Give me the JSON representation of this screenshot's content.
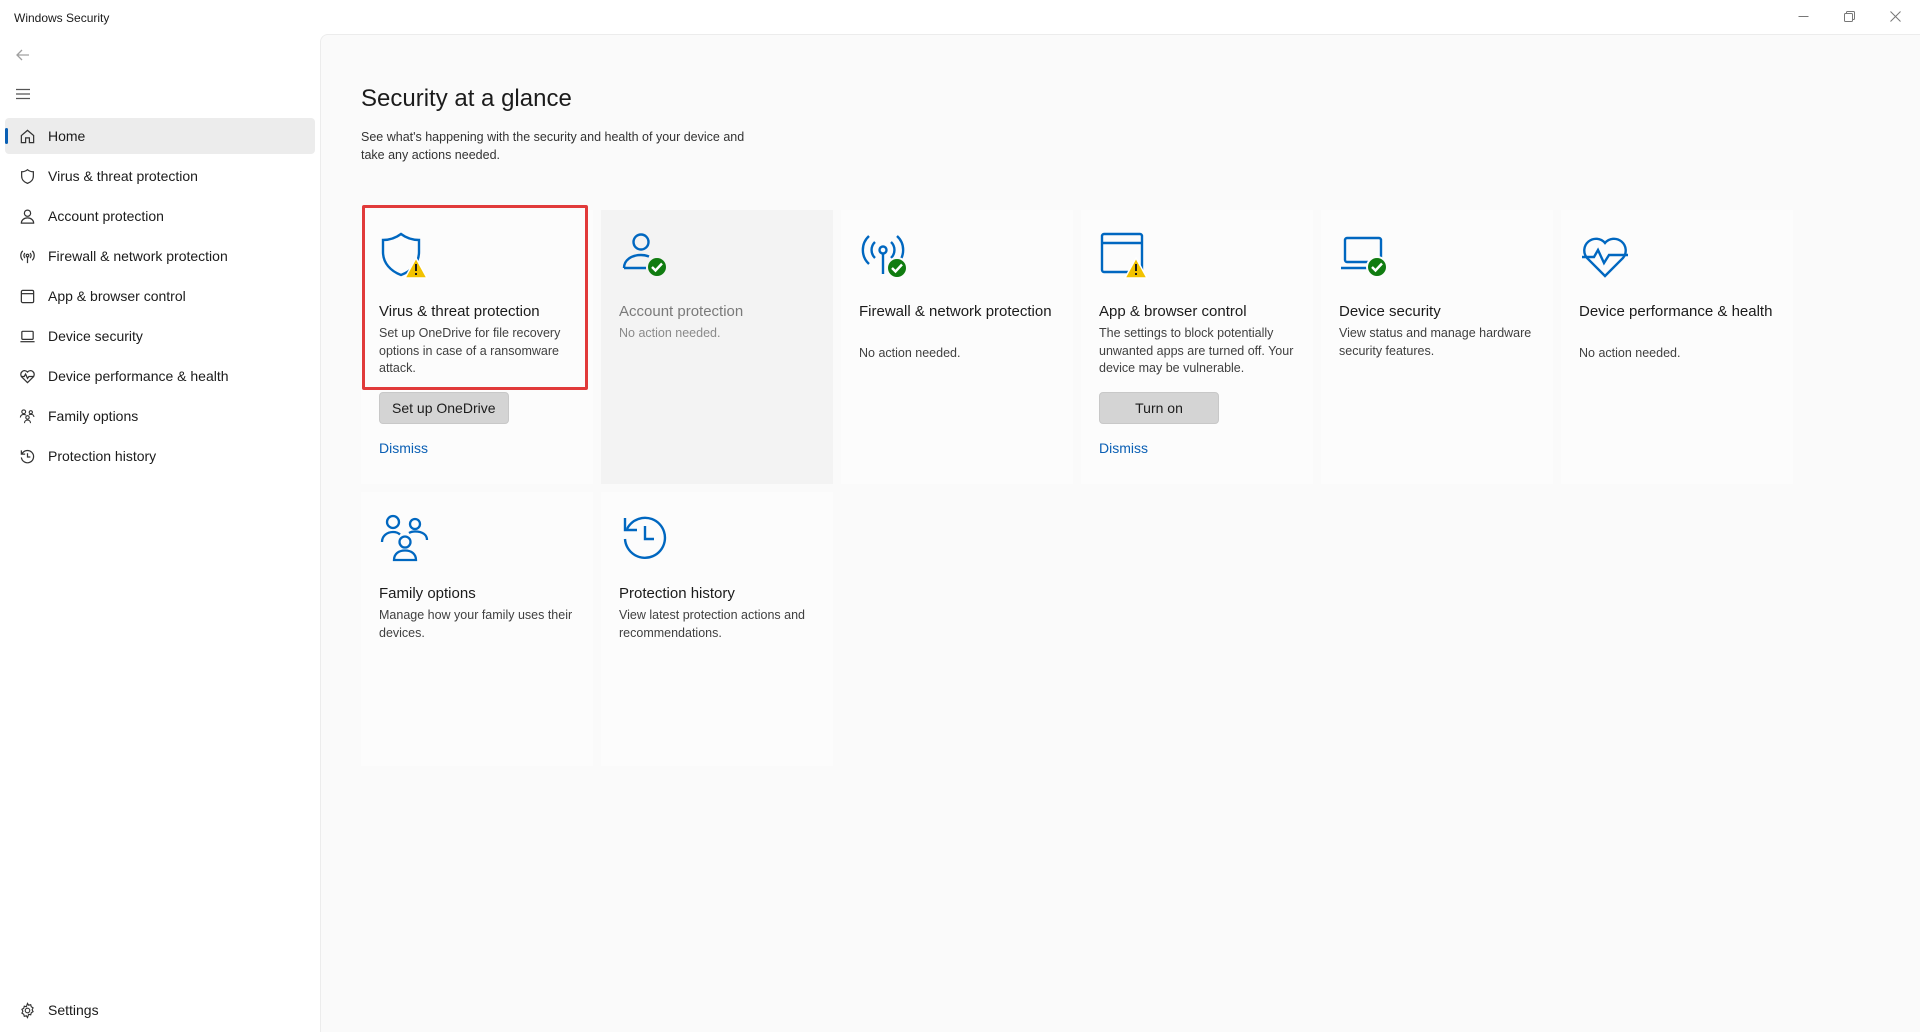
{
  "window": {
    "title": "Windows Security",
    "controls": [
      "minimize-icon",
      "maximize-icon",
      "close-icon"
    ]
  },
  "sidebar": {
    "items": [
      {
        "label": "Home",
        "icon": "home-icon",
        "active": true
      },
      {
        "label": "Virus & threat protection",
        "icon": "shield-icon"
      },
      {
        "label": "Account protection",
        "icon": "person-icon"
      },
      {
        "label": "Firewall & network protection",
        "icon": "antenna-icon"
      },
      {
        "label": "App & browser control",
        "icon": "app-window-icon"
      },
      {
        "label": "Device security",
        "icon": "laptop-icon"
      },
      {
        "label": "Device performance & health",
        "icon": "heart-pulse-icon"
      },
      {
        "label": "Family options",
        "icon": "family-icon"
      },
      {
        "label": "Protection history",
        "icon": "history-icon"
      }
    ],
    "settings_label": "Settings"
  },
  "main": {
    "title": "Security at a glance",
    "subtitle": "See what's happening with the security and health of your device and take any actions needed.",
    "cards": [
      {
        "title": "Virus & threat protection",
        "description": "Set up OneDrive for file recovery options in case of a ransomware attack.",
        "button": "Set up OneDrive",
        "link": "Dismiss",
        "icon": "shield-warning-icon"
      },
      {
        "title": "Account protection",
        "description": "No action needed.",
        "icon": "person-check-icon"
      },
      {
        "title": "Firewall & network protection",
        "description": "No action needed.",
        "icon": "antenna-check-icon"
      },
      {
        "title": "App & browser control",
        "description": "The settings to block potentially unwanted apps are turned off. Your device may be vulnerable.",
        "button": "Turn on",
        "link": "Dismiss",
        "icon": "app-window-warning-icon"
      },
      {
        "title": "Device security",
        "description": "View status and manage hardware security features.",
        "icon": "laptop-check-icon"
      },
      {
        "title": "Device performance & health",
        "description": "No action needed.",
        "icon": "heart-pulse-icon"
      },
      {
        "title": "Family options",
        "description": "Manage how your family uses their devices.",
        "icon": "family-icon"
      },
      {
        "title": "Protection history",
        "description": "View latest protection actions and recommendations.",
        "icon": "history-icon"
      }
    ]
  },
  "colors": {
    "accent": "#0a5fb4",
    "icon_blue": "#0067c0",
    "success_green": "#107c10",
    "warning_yellow": "#f2c200",
    "highlight_red": "#e13a3a"
  }
}
